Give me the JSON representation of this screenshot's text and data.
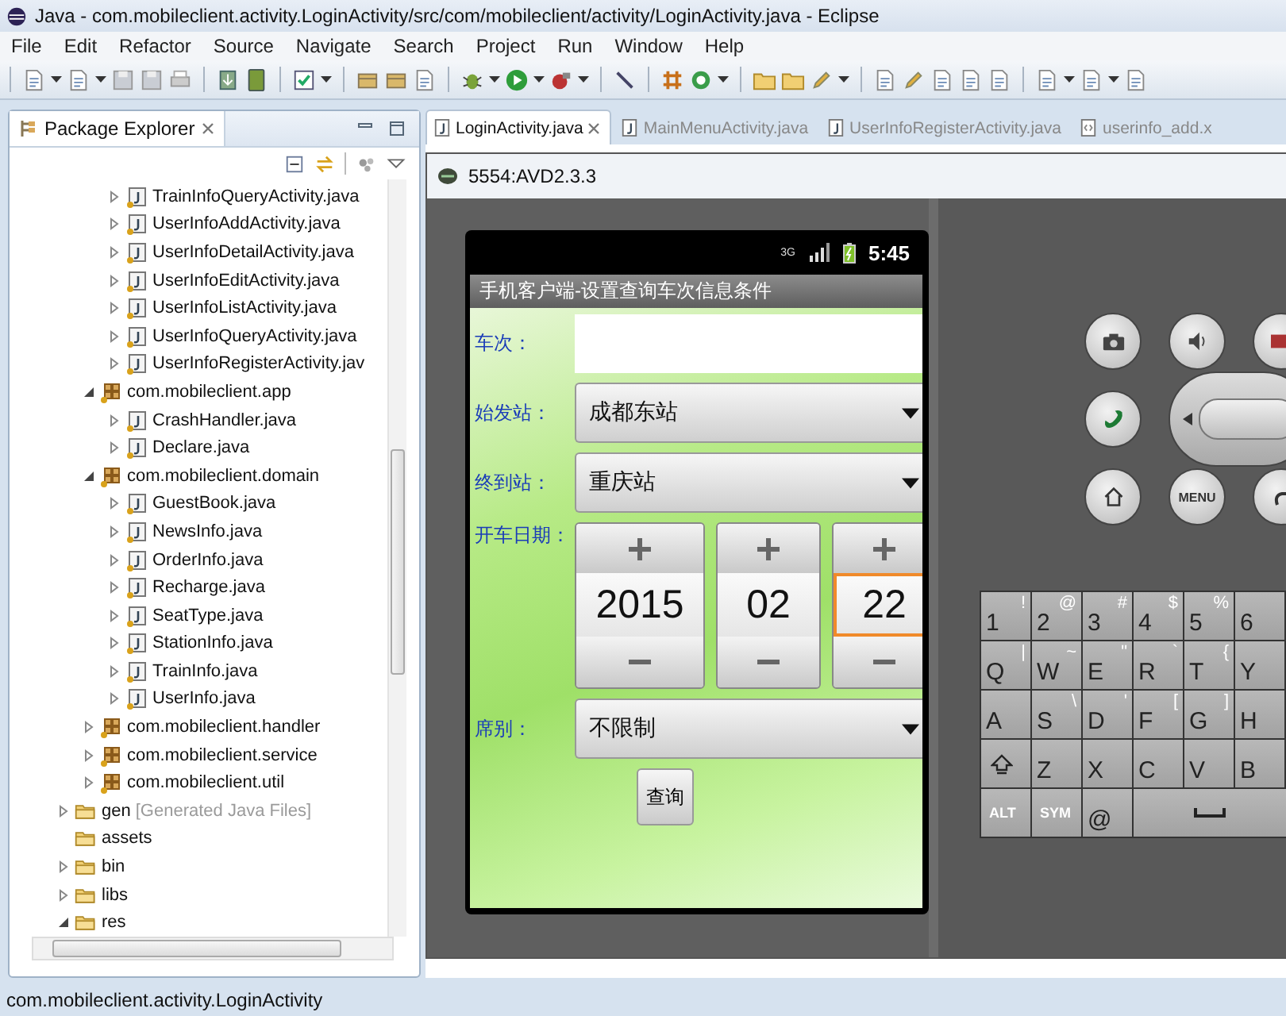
{
  "window": {
    "title": "Java - com.mobileclient.activity.LoginActivity/src/com/mobileclient/activity/LoginActivity.java - Eclipse"
  },
  "menu": [
    "File",
    "Edit",
    "Refactor",
    "Source",
    "Navigate",
    "Search",
    "Project",
    "Run",
    "Window",
    "Help"
  ],
  "package_explorer": {
    "title": "Package Explorer",
    "tree": [
      {
        "kind": "group",
        "children": [
          {
            "kind": "group",
            "children": [
              {
                "kind": "file",
                "label": "TrainInfoQueryActivity.java",
                "expanded": false
              },
              {
                "kind": "file",
                "label": "UserInfoAddActivity.java",
                "expanded": false
              },
              {
                "kind": "file",
                "label": "UserInfoDetailActivity.java",
                "expanded": false
              },
              {
                "kind": "file",
                "label": "UserInfoEditActivity.java",
                "expanded": false
              },
              {
                "kind": "file",
                "label": "UserInfoListActivity.java",
                "expanded": false
              },
              {
                "kind": "file",
                "label": "UserInfoQueryActivity.java",
                "expanded": false
              },
              {
                "kind": "file",
                "label": "UserInfoRegisterActivity.jav",
                "expanded": false
              }
            ]
          },
          {
            "kind": "package",
            "label": "com.mobileclient.app",
            "expanded": true,
            "children": [
              {
                "kind": "file",
                "label": "CrashHandler.java",
                "expanded": false
              },
              {
                "kind": "file",
                "label": "Declare.java",
                "expanded": false
              }
            ]
          },
          {
            "kind": "package",
            "label": "com.mobileclient.domain",
            "expanded": true,
            "children": [
              {
                "kind": "file",
                "label": "GuestBook.java",
                "expanded": false
              },
              {
                "kind": "file",
                "label": "NewsInfo.java",
                "expanded": false
              },
              {
                "kind": "file",
                "label": "OrderInfo.java",
                "expanded": false
              },
              {
                "kind": "file",
                "label": "Recharge.java",
                "expanded": false
              },
              {
                "kind": "file",
                "label": "SeatType.java",
                "expanded": false
              },
              {
                "kind": "file",
                "label": "StationInfo.java",
                "expanded": false
              },
              {
                "kind": "file",
                "label": "TrainInfo.java",
                "expanded": false
              },
              {
                "kind": "file",
                "label": "UserInfo.java",
                "expanded": false
              }
            ]
          },
          {
            "kind": "package",
            "label": "com.mobileclient.handler",
            "expanded": false
          },
          {
            "kind": "package",
            "label": "com.mobileclient.service",
            "expanded": false
          },
          {
            "kind": "package",
            "label": "com.mobileclient.util",
            "expanded": false
          }
        ]
      },
      {
        "kind": "folder",
        "label": "gen",
        "decoration": "[Generated Java Files]",
        "expanded": false
      },
      {
        "kind": "folder",
        "label": "assets"
      },
      {
        "kind": "folder",
        "label": "bin",
        "expanded": false
      },
      {
        "kind": "folder",
        "label": "libs",
        "expanded": false
      },
      {
        "kind": "folder",
        "label": "res",
        "expanded": true
      }
    ]
  },
  "editor_tabs": [
    {
      "label": "LoginActivity.java",
      "selected": true,
      "kind": "java"
    },
    {
      "label": "MainMenuActivity.java",
      "selected": false,
      "kind": "java"
    },
    {
      "label": "UserInfoRegisterActivity.java",
      "selected": false,
      "kind": "java"
    },
    {
      "label": "userinfo_add.x",
      "selected": false,
      "kind": "xml"
    }
  ],
  "emulator": {
    "title": "5554:AVD2.3.3",
    "phone_status": {
      "network": "3G",
      "time": "5:45"
    },
    "app_title": "手机客户端-设置查询车次信息条件",
    "form": [
      {
        "kind": "input",
        "label": "车次："
      },
      {
        "kind": "spinner",
        "label": "始发站：",
        "value": "成都东站"
      },
      {
        "kind": "spinner",
        "label": "终到站：",
        "value": "重庆站"
      },
      {
        "kind": "date",
        "label": "开车日期：",
        "parts": [
          {
            "value": "2015",
            "focused": false
          },
          {
            "value": "02",
            "focused": false
          },
          {
            "value": "22",
            "focused": true
          }
        ]
      },
      {
        "kind": "spinner",
        "label": "席别：",
        "value": "不限制"
      }
    ],
    "submit": "查询",
    "menu_key": "MENU",
    "keyboard": [
      {
        "keys": [
          {
            "kind": "char",
            "label": "1",
            "alt": "!"
          },
          {
            "kind": "char",
            "label": "2",
            "alt": "@"
          },
          {
            "kind": "char",
            "label": "3",
            "alt": "#"
          },
          {
            "kind": "char",
            "label": "4",
            "alt": "$"
          },
          {
            "kind": "char",
            "label": "5",
            "alt": "%"
          },
          {
            "kind": "char",
            "label": "6"
          }
        ]
      },
      {
        "keys": [
          {
            "kind": "char",
            "label": "Q",
            "alt": "|"
          },
          {
            "kind": "char",
            "label": "W",
            "alt": "~"
          },
          {
            "kind": "char",
            "label": "E",
            "alt": "\""
          },
          {
            "kind": "char",
            "label": "R",
            "alt": "`"
          },
          {
            "kind": "char",
            "label": "T",
            "alt": "{"
          },
          {
            "kind": "char",
            "label": "Y"
          }
        ]
      },
      {
        "keys": [
          {
            "kind": "char",
            "label": "A"
          },
          {
            "kind": "char",
            "label": "S",
            "alt": "\\"
          },
          {
            "kind": "char",
            "label": "D",
            "alt": "'"
          },
          {
            "kind": "char",
            "label": "F",
            "alt": "["
          },
          {
            "kind": "char",
            "label": "G",
            "alt": "]"
          },
          {
            "kind": "char",
            "label": "H"
          }
        ]
      },
      {
        "keys": [
          {
            "kind": "shift"
          },
          {
            "kind": "char",
            "label": "Z"
          },
          {
            "kind": "char",
            "label": "X"
          },
          {
            "kind": "char",
            "label": "C"
          },
          {
            "kind": "char",
            "label": "V"
          },
          {
            "kind": "char",
            "label": "B"
          }
        ]
      },
      {
        "keys": [
          {
            "kind": "mod",
            "label": "ALT"
          },
          {
            "kind": "mod",
            "label": "SYM"
          },
          {
            "kind": "char",
            "label": "@"
          },
          {
            "kind": "space"
          }
        ]
      }
    ]
  },
  "status_bar": "com.mobileclient.activity.LoginActivity"
}
